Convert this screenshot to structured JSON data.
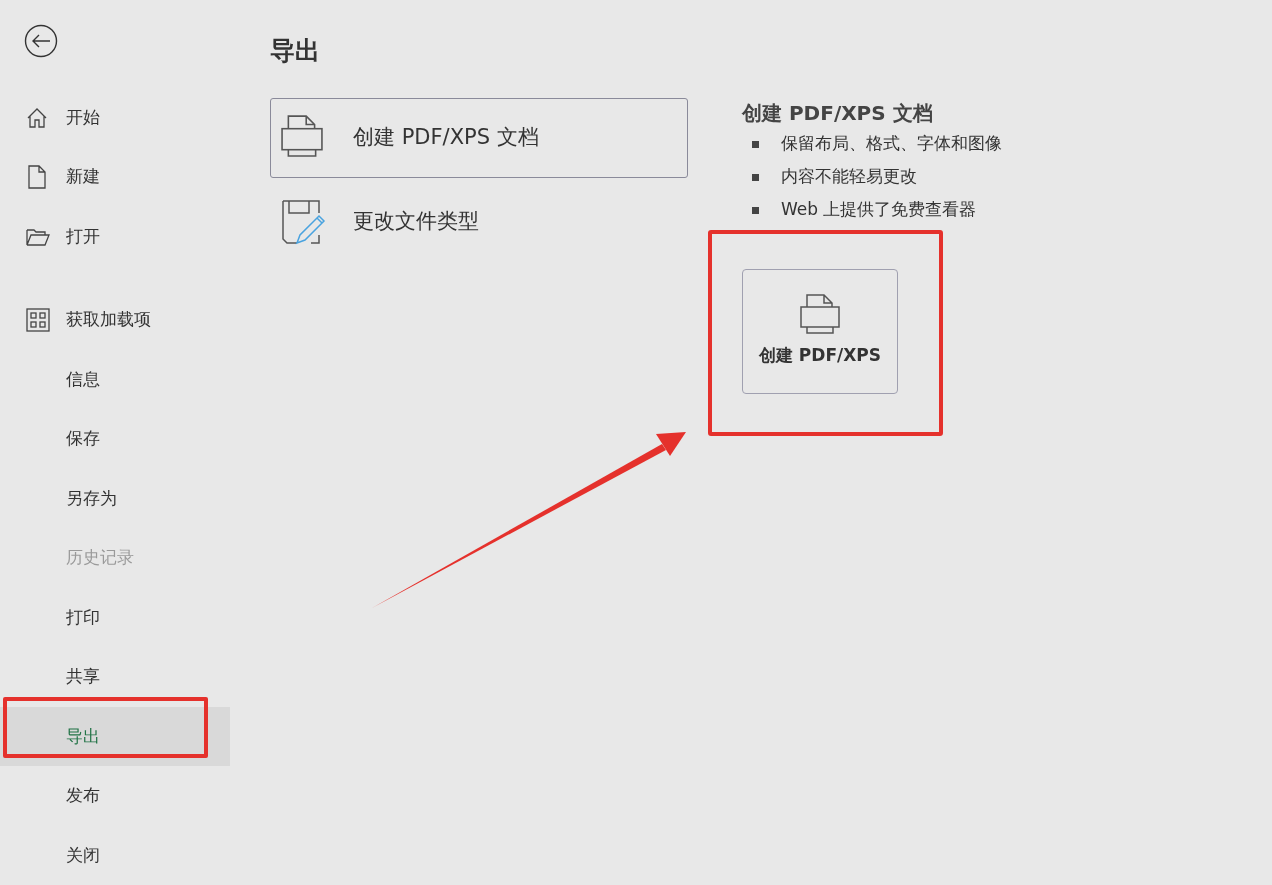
{
  "sidebar": {
    "top_items": [
      {
        "label": "开始",
        "selected": false
      },
      {
        "label": "新建",
        "selected": false
      },
      {
        "label": "打开",
        "selected": false
      }
    ],
    "addins": {
      "label": "获取加载项",
      "selected": false
    },
    "items": [
      {
        "label": "信息",
        "selected": false,
        "disabled": false
      },
      {
        "label": "保存",
        "selected": false,
        "disabled": false
      },
      {
        "label": "另存为",
        "selected": false,
        "disabled": false
      },
      {
        "label": "历史记录",
        "selected": false,
        "disabled": true
      },
      {
        "label": "打印",
        "selected": false,
        "disabled": false
      },
      {
        "label": "共享",
        "selected": false,
        "disabled": false
      },
      {
        "label": "导出",
        "selected": true,
        "disabled": false
      },
      {
        "label": "发布",
        "selected": false,
        "disabled": false
      },
      {
        "label": "关闭",
        "selected": false,
        "disabled": false
      }
    ]
  },
  "page_title": "导出",
  "export_options": [
    {
      "label": "创建 PDF/XPS 文档",
      "selected": true
    },
    {
      "label": "更改文件类型",
      "selected": false
    }
  ],
  "detail": {
    "title": "创建 PDF/XPS 文档",
    "bullets": [
      "保留布局、格式、字体和图像",
      "内容不能轻易更改",
      "Web 上提供了免费查看器"
    ],
    "button": "创建 PDF/XPS"
  }
}
